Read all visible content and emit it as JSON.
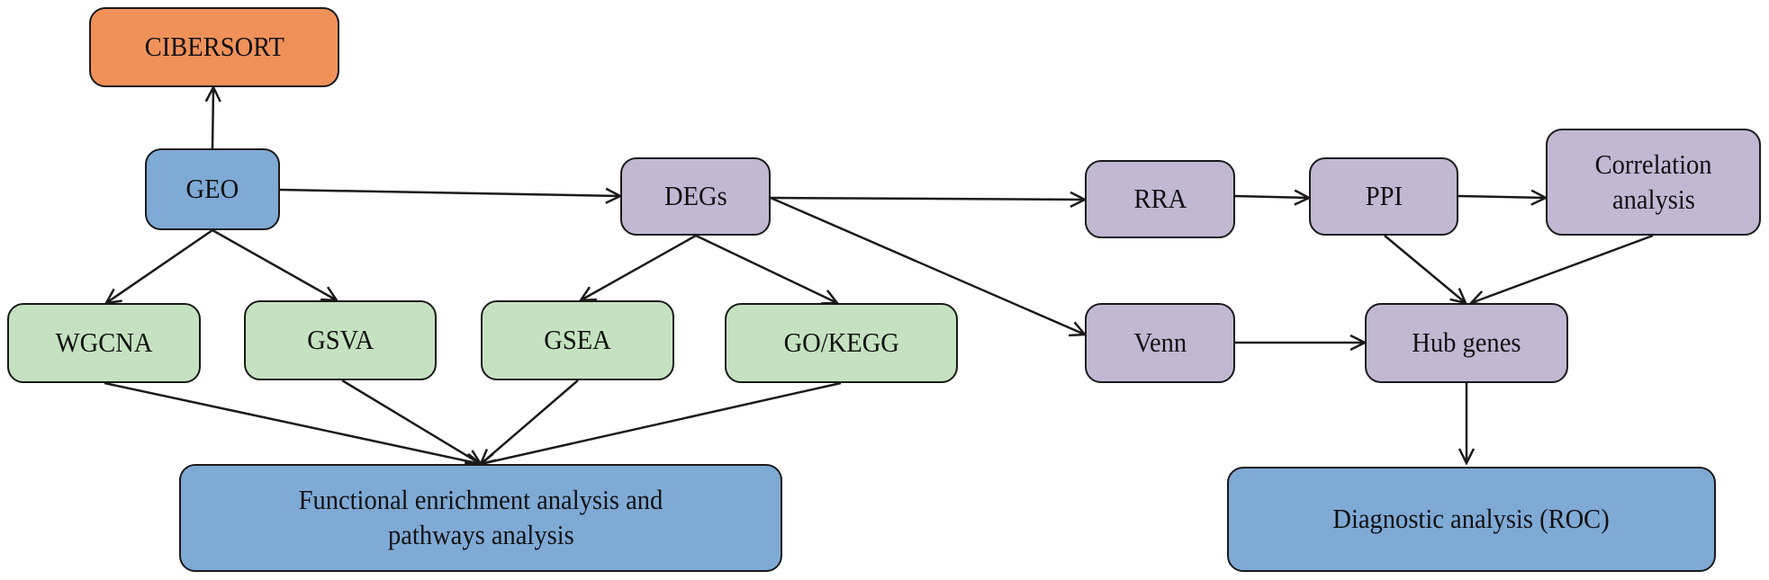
{
  "colors": {
    "source": "#F0915A",
    "primary": "#7FAAD6",
    "deg_branch": "#C2B8D4",
    "enrichment": "#C5E2C0",
    "line": "#1a1a1a"
  },
  "nodes": {
    "cibersort": "CIBERSORT",
    "geo": "GEO",
    "degs": "DEGs",
    "wgcna": "WGCNA",
    "gsva": "GSVA",
    "gsea": "GSEA",
    "gokegg": "GO/KEGG",
    "functional_line1": "Functional enrichment analysis and",
    "functional_line2": "pathways analysis",
    "rra": "RRA",
    "ppi": "PPI",
    "correlation_line1": "Correlation",
    "correlation_line2": "analysis",
    "venn": "Venn",
    "hub": "Hub genes",
    "diagnostic": "Diagnostic analysis (ROC)"
  },
  "edges": [
    [
      "GEO",
      "CIBERSORT"
    ],
    [
      "GEO",
      "DEGs"
    ],
    [
      "GEO",
      "WGCNA"
    ],
    [
      "GEO",
      "GSVA"
    ],
    [
      "DEGs",
      "GSEA"
    ],
    [
      "DEGs",
      "GO/KEGG"
    ],
    [
      "DEGs",
      "RRA"
    ],
    [
      "DEGs",
      "Venn"
    ],
    [
      "RRA",
      "PPI"
    ],
    [
      "PPI",
      "Correlation analysis"
    ],
    [
      "PPI",
      "Hub genes"
    ],
    [
      "Correlation analysis",
      "Hub genes"
    ],
    [
      "Venn",
      "Hub genes"
    ],
    [
      "Hub genes",
      "Diagnostic analysis (ROC)"
    ],
    [
      "WGCNA",
      "Functional enrichment analysis and pathways analysis"
    ],
    [
      "GSVA",
      "Functional enrichment analysis and pathways analysis"
    ],
    [
      "GSEA",
      "Functional enrichment analysis and pathways analysis"
    ],
    [
      "GO/KEGG",
      "Functional enrichment analysis and pathways analysis"
    ]
  ]
}
